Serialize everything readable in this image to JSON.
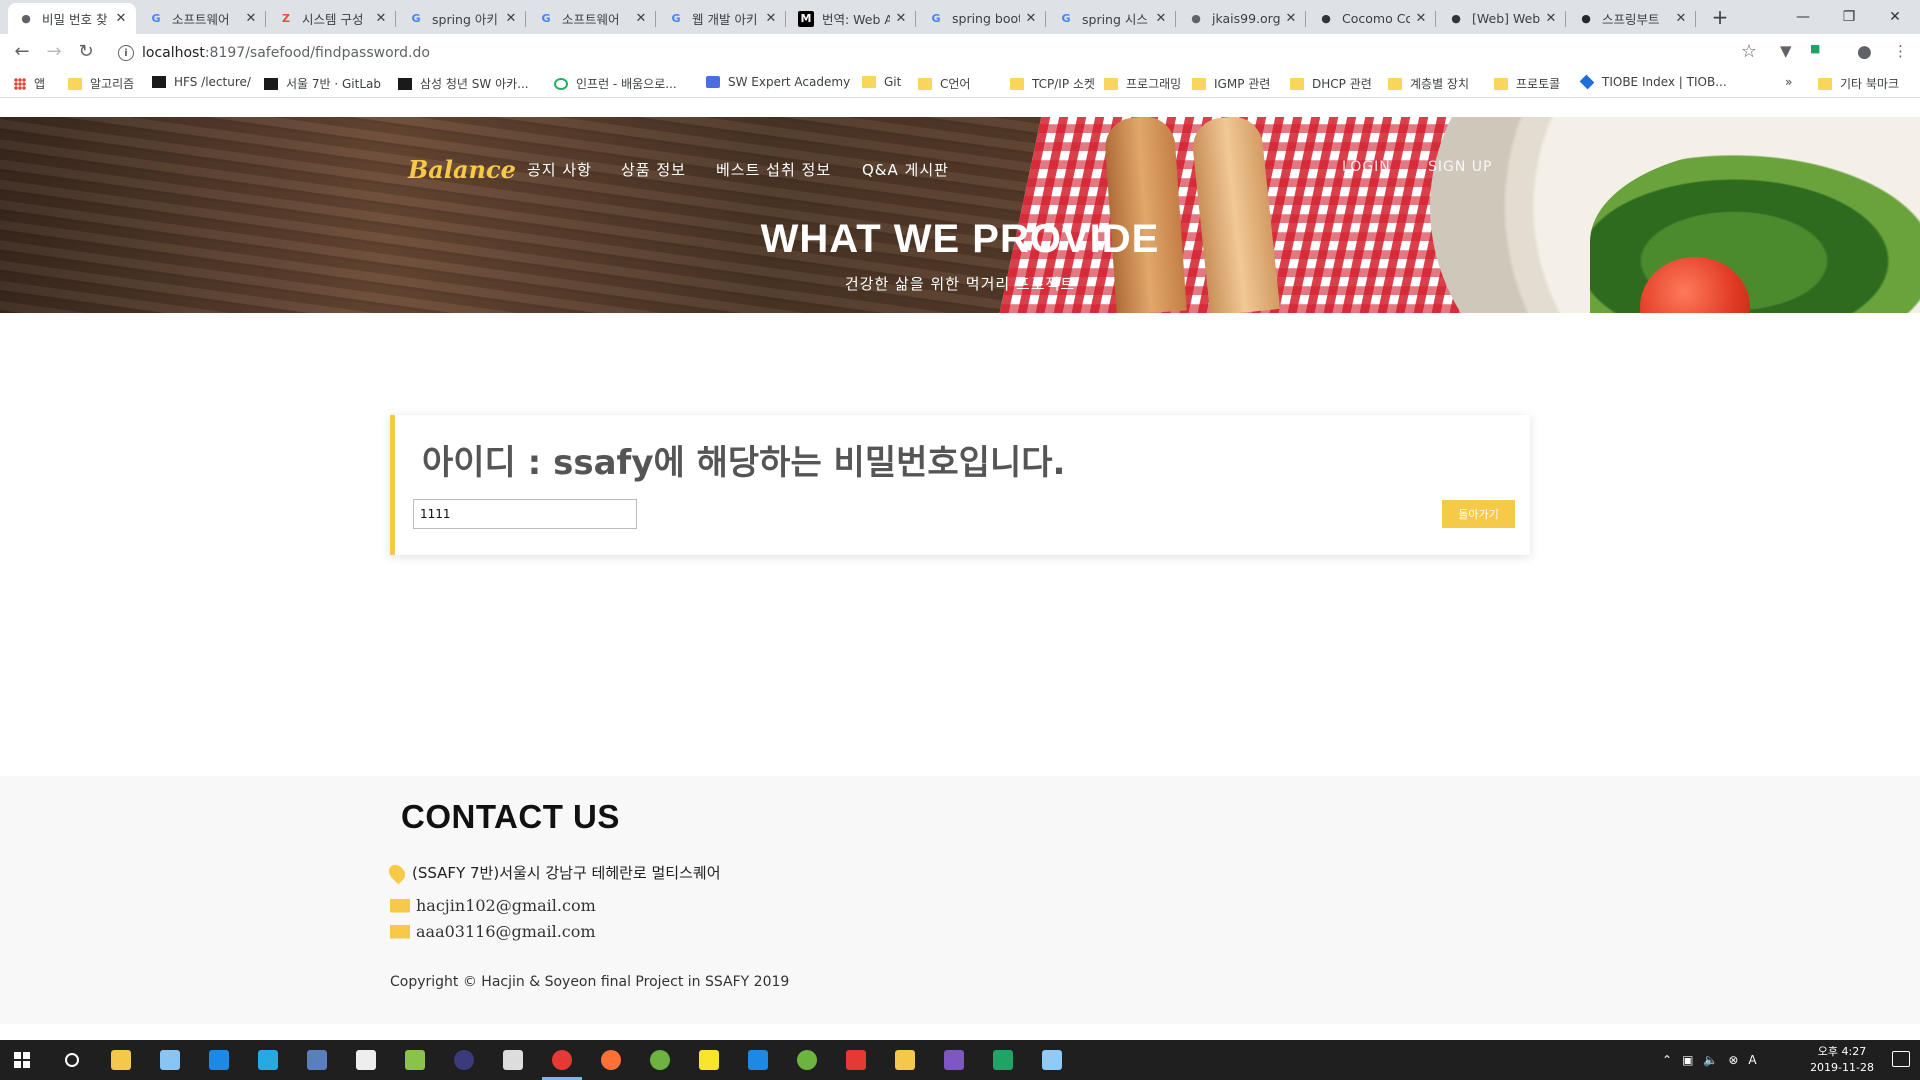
{
  "browser": {
    "tabs": [
      {
        "title": "비밀 번호 찾",
        "favicon": "globe-icon",
        "color": "#5f6368",
        "active": true
      },
      {
        "title": "소프트웨어",
        "favicon": "google-icon",
        "color": "#4285f4"
      },
      {
        "title": "시스템 구성",
        "favicon": "z-icon",
        "color": "#e74c3c"
      },
      {
        "title": "spring 아키",
        "favicon": "google-icon",
        "color": "#4285f4"
      },
      {
        "title": "소프트웨어",
        "favicon": "google-icon",
        "color": "#4285f4"
      },
      {
        "title": "웹 개발 아키",
        "favicon": "google-icon",
        "color": "#4285f4"
      },
      {
        "title": "번역: Web A",
        "favicon": "medium-icon",
        "color": "#000000"
      },
      {
        "title": "spring boot",
        "favicon": "google-icon",
        "color": "#4285f4"
      },
      {
        "title": "spring 시스",
        "favicon": "google-icon",
        "color": "#4285f4"
      },
      {
        "title": "jkais99.org/",
        "favicon": "globe-icon",
        "color": "#5f6368"
      },
      {
        "title": "Cocomo Co",
        "favicon": "dots-icon",
        "color": "#333333"
      },
      {
        "title": "[Web] Web",
        "favicon": "penguin-icon",
        "color": "#333333"
      },
      {
        "title": "스프링부트",
        "favicon": "github-icon",
        "color": "#24292e"
      }
    ],
    "url_host": "localhost",
    "url_path": ":8197/safefood/findpassword.do",
    "bookmarks": [
      {
        "label": "앱",
        "icon": "dots"
      },
      {
        "label": "알고리즘",
        "icon": "folder"
      },
      {
        "label": "HFS /lecture/",
        "icon": "sq"
      },
      {
        "label": "서울 7반 · GitLab",
        "icon": "sq"
      },
      {
        "label": "삼성 청년 SW 아카...",
        "icon": "sq"
      },
      {
        "label": "인프런 - 배움으로...",
        "icon": "green"
      },
      {
        "label": "SW Expert Academy",
        "icon": "blue"
      },
      {
        "label": "Git",
        "icon": "folder"
      },
      {
        "label": "C언어",
        "icon": "folder"
      },
      {
        "label": "TCP/IP 소켓",
        "icon": "folder"
      },
      {
        "label": "프로그래밍",
        "icon": "folder"
      },
      {
        "label": "IGMP 관련",
        "icon": "folder"
      },
      {
        "label": "DHCP 관련",
        "icon": "folder"
      },
      {
        "label": "계층별 장치",
        "icon": "folder"
      },
      {
        "label": "프로토콜",
        "icon": "folder"
      },
      {
        "label": "TIOBE Index | TIOB...",
        "icon": "diamond"
      }
    ],
    "bookmarks_more": "»",
    "other_bookmarks": "기타 북마크"
  },
  "site": {
    "brand": "Balance",
    "nav": [
      "공지 사항",
      "상품 정보",
      "베스트 섭취 정보",
      "Q&A 게시판"
    ],
    "login": "LOGIN",
    "signup": "SIGN UP",
    "hero_title": "WHAT WE PROVIDE",
    "hero_subtitle": "건강한 삶을 위한 먹거리 프로젝트"
  },
  "result": {
    "message": "아이디 : ssafy에 해당하는 비밀번호입니다.",
    "password_value": "1111",
    "back_button": "돌아가기"
  },
  "footer": {
    "title": "CONTACT US",
    "address": "(SSAFY 7반)서울시 강남구 테헤란로 멀티스퀘어",
    "email1": "hacjin102@gmail.com",
    "email2": "aaa03116@gmail.com",
    "copyright": "Copyright © Hacjin & Soyeon final Project in SSAFY 2019"
  },
  "taskbar": {
    "apps": [
      {
        "name": "search-icon",
        "color": "#ffffff"
      },
      {
        "name": "file-explorer-icon",
        "color": "#f4c84a"
      },
      {
        "name": "notepad-icon",
        "color": "#8ac4f2"
      },
      {
        "name": "edge-icon",
        "color": "#1e88e5"
      },
      {
        "name": "ie-icon",
        "color": "#29a9e1"
      },
      {
        "name": "studio-icon",
        "color": "#5a7fbf"
      },
      {
        "name": "typora-icon",
        "color": "#eeeeee"
      },
      {
        "name": "notepadpp-icon",
        "color": "#8bc34a"
      },
      {
        "name": "eclipse-icon",
        "color": "#3b3a7a"
      },
      {
        "name": "paint-icon",
        "color": "#dddddd"
      },
      {
        "name": "chrome-icon",
        "color": "#e53935"
      },
      {
        "name": "firefox-icon",
        "color": "#ff7139"
      },
      {
        "name": "spring-icon",
        "color": "#6db33f"
      },
      {
        "name": "sticky-notes-icon",
        "color": "#f9e62c"
      },
      {
        "name": "vscode-icon",
        "color": "#1e88e5"
      },
      {
        "name": "sts-icon",
        "color": "#6db33f"
      },
      {
        "name": "acrobat-icon",
        "color": "#e53935"
      },
      {
        "name": "git-icon",
        "color": "#f4c84a"
      },
      {
        "name": "game-icon",
        "color": "#7e57c2"
      },
      {
        "name": "excel-icon",
        "color": "#21a366"
      },
      {
        "name": "paint3d-icon",
        "color": "#90caf9"
      }
    ],
    "time": "오후 4:27",
    "date": "2019-11-28",
    "ime": "A"
  }
}
